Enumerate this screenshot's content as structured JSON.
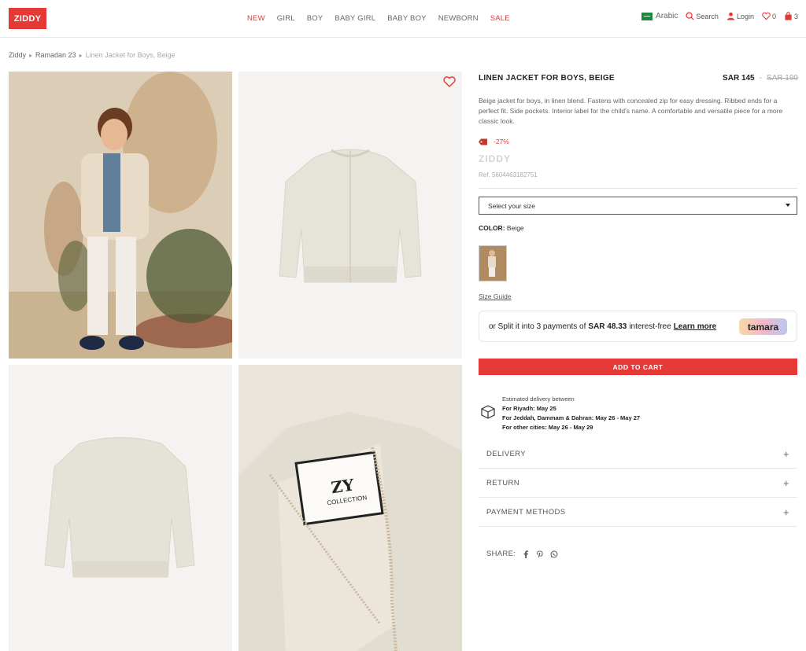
{
  "header": {
    "logo": "ZIDDY",
    "nav": [
      {
        "label": "NEW",
        "highlight": true
      },
      {
        "label": "GIRL",
        "highlight": false
      },
      {
        "label": "BOY",
        "highlight": false
      },
      {
        "label": "BABY GIRL",
        "highlight": false
      },
      {
        "label": "BABY BOY",
        "highlight": false
      },
      {
        "label": "NEWBORN",
        "highlight": false
      },
      {
        "label": "SALE",
        "highlight": true
      }
    ],
    "language": "Arabic",
    "search_label": "Search",
    "login_label": "Login",
    "wishlist_count": "0",
    "cart_count": "3"
  },
  "breadcrumb": {
    "items": [
      "Ziddy",
      "Ramadan 23"
    ],
    "current": "Linen Jacket for Boys, Beige"
  },
  "product": {
    "title": "LINEN JACKET FOR BOYS, BEIGE",
    "price_now": "SAR 145",
    "price_dash": "-",
    "price_old": "SAR 199",
    "description": "Beige jacket for boys, in linen blend. Fastens with concealed zip for easy dressing. Ribbed ends for a perfect fit. Side pockets. Interior label for the child's name. A comfortable and versatile piece for a more classic look.",
    "discount": "-27%",
    "brand": "ZIDDY",
    "ref": "Ref. 5604463182751",
    "size_placeholder": "Select your size",
    "color_label": "COLOR:",
    "color_value": "Beige",
    "size_guide": "Size Guide"
  },
  "tamara": {
    "prefix": "or Split it into 3 payments of",
    "amount": "SAR 48.33",
    "suffix": "interest-free",
    "link": "Learn more",
    "logo": "tamara"
  },
  "cart_button": "ADD TO CART",
  "delivery_estimate": {
    "heading": "Estimated delivery between",
    "riyadh": "For Riyadh: May 25",
    "jeddah": "For Jeddah, Dammam & Dahran: May 26  -  May 27",
    "other": "For other cities: May 26  -  May 29"
  },
  "accordion": [
    "DELIVERY",
    "RETURN",
    "PAYMENT METHODS"
  ],
  "share_label": "SHARE:",
  "label_text": {
    "line1": "ZY",
    "line2": "COLLECTION"
  },
  "colors": {
    "accent": "#e53935",
    "text": "#222222",
    "muted": "#aaaaaa"
  }
}
